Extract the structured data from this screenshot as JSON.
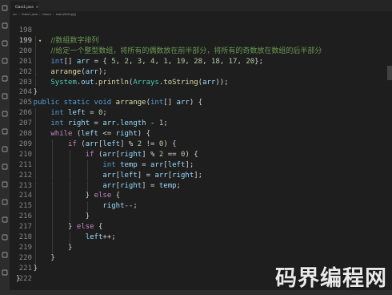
{
  "tab": {
    "label": "Class1.java"
  },
  "breadcrumb": [
    "src",
    "Class1.java",
    "Class1",
    "main(String[])"
  ],
  "lines": [
    {
      "n": "198",
      "indent": 0,
      "parts": []
    },
    {
      "n": "199",
      "indent": 2,
      "parts": [
        {
          "c": "cmt",
          "t": "//数组数字排列"
        }
      ],
      "marker": "💡"
    },
    {
      "n": "200",
      "indent": 2,
      "parts": [
        {
          "c": "cmt",
          "t": "//给定一个整型数组，将所有的偶数放在前半部分，将所有的奇数放在数组的后半部分"
        }
      ]
    },
    {
      "n": "201",
      "indent": 2,
      "parts": [
        {
          "c": "kw",
          "t": "int"
        },
        {
          "c": "",
          "t": "[] "
        },
        {
          "c": "var",
          "t": "arr"
        },
        {
          "c": "",
          "t": " = { "
        },
        {
          "c": "num",
          "t": "5"
        },
        {
          "c": "",
          "t": ", "
        },
        {
          "c": "num",
          "t": "2"
        },
        {
          "c": "",
          "t": ", "
        },
        {
          "c": "num",
          "t": "3"
        },
        {
          "c": "",
          "t": ", "
        },
        {
          "c": "num",
          "t": "4"
        },
        {
          "c": "",
          "t": ", "
        },
        {
          "c": "num",
          "t": "1"
        },
        {
          "c": "",
          "t": ", "
        },
        {
          "c": "num",
          "t": "19"
        },
        {
          "c": "",
          "t": ", "
        },
        {
          "c": "num",
          "t": "28"
        },
        {
          "c": "",
          "t": ", "
        },
        {
          "c": "num",
          "t": "18"
        },
        {
          "c": "",
          "t": ", "
        },
        {
          "c": "num",
          "t": "17"
        },
        {
          "c": "",
          "t": ", "
        },
        {
          "c": "num",
          "t": "20"
        },
        {
          "c": "",
          "t": "};"
        }
      ]
    },
    {
      "n": "202",
      "indent": 2,
      "parts": [
        {
          "c": "fn",
          "t": "arrange"
        },
        {
          "c": "",
          "t": "("
        },
        {
          "c": "var",
          "t": "arr"
        },
        {
          "c": "",
          "t": ");"
        }
      ]
    },
    {
      "n": "203",
      "indent": 2,
      "parts": [
        {
          "c": "typ",
          "t": "System"
        },
        {
          "c": "",
          "t": "."
        },
        {
          "c": "var",
          "t": "out"
        },
        {
          "c": "",
          "t": "."
        },
        {
          "c": "fn",
          "t": "println"
        },
        {
          "c": "",
          "t": "("
        },
        {
          "c": "typ",
          "t": "Arrays"
        },
        {
          "c": "",
          "t": "."
        },
        {
          "c": "fn",
          "t": "toString"
        },
        {
          "c": "",
          "t": "("
        },
        {
          "c": "var",
          "t": "arr"
        },
        {
          "c": "",
          "t": "));"
        }
      ]
    },
    {
      "n": "204",
      "indent": 1,
      "parts": [
        {
          "c": "",
          "t": "}"
        }
      ]
    },
    {
      "n": "205",
      "indent": 1,
      "parts": [
        {
          "c": "kw",
          "t": "public"
        },
        {
          "c": "",
          "t": " "
        },
        {
          "c": "kw",
          "t": "static"
        },
        {
          "c": "",
          "t": " "
        },
        {
          "c": "kw",
          "t": "void"
        },
        {
          "c": "",
          "t": " "
        },
        {
          "c": "fn",
          "t": "arrange"
        },
        {
          "c": "",
          "t": "("
        },
        {
          "c": "kw",
          "t": "int"
        },
        {
          "c": "",
          "t": "[] "
        },
        {
          "c": "var",
          "t": "arr"
        },
        {
          "c": "",
          "t": ") {"
        }
      ]
    },
    {
      "n": "206",
      "indent": 2,
      "parts": [
        {
          "c": "kw",
          "t": "int"
        },
        {
          "c": "",
          "t": " "
        },
        {
          "c": "var",
          "t": "left"
        },
        {
          "c": "",
          "t": " = "
        },
        {
          "c": "num",
          "t": "0"
        },
        {
          "c": "",
          "t": ";"
        }
      ]
    },
    {
      "n": "207",
      "indent": 2,
      "parts": [
        {
          "c": "kw",
          "t": "int"
        },
        {
          "c": "",
          "t": " "
        },
        {
          "c": "var",
          "t": "right"
        },
        {
          "c": "",
          "t": " = "
        },
        {
          "c": "var",
          "t": "arr"
        },
        {
          "c": "",
          "t": "."
        },
        {
          "c": "var",
          "t": "length"
        },
        {
          "c": "",
          "t": " - "
        },
        {
          "c": "num",
          "t": "1"
        },
        {
          "c": "",
          "t": ";"
        }
      ]
    },
    {
      "n": "208",
      "indent": 2,
      "parts": [
        {
          "c": "ctl",
          "t": "while"
        },
        {
          "c": "",
          "t": " ("
        },
        {
          "c": "var",
          "t": "left"
        },
        {
          "c": "",
          "t": " <= "
        },
        {
          "c": "var",
          "t": "right"
        },
        {
          "c": "",
          "t": ") {"
        }
      ]
    },
    {
      "n": "209",
      "indent": 3,
      "parts": [
        {
          "c": "ctl",
          "t": "if"
        },
        {
          "c": "",
          "t": " ("
        },
        {
          "c": "var",
          "t": "arr"
        },
        {
          "c": "",
          "t": "["
        },
        {
          "c": "var",
          "t": "left"
        },
        {
          "c": "",
          "t": "] % "
        },
        {
          "c": "num",
          "t": "2"
        },
        {
          "c": "",
          "t": " != "
        },
        {
          "c": "num",
          "t": "0"
        },
        {
          "c": "",
          "t": ") {"
        }
      ]
    },
    {
      "n": "210",
      "indent": 4,
      "parts": [
        {
          "c": "ctl",
          "t": "if"
        },
        {
          "c": "",
          "t": " ("
        },
        {
          "c": "var",
          "t": "arr"
        },
        {
          "c": "",
          "t": "["
        },
        {
          "c": "var",
          "t": "right"
        },
        {
          "c": "",
          "t": "] % "
        },
        {
          "c": "num",
          "t": "2"
        },
        {
          "c": "",
          "t": " == "
        },
        {
          "c": "num",
          "t": "0"
        },
        {
          "c": "",
          "t": ") {"
        }
      ]
    },
    {
      "n": "211",
      "indent": 5,
      "parts": [
        {
          "c": "kw",
          "t": "int"
        },
        {
          "c": "",
          "t": " "
        },
        {
          "c": "var",
          "t": "temp"
        },
        {
          "c": "",
          "t": " = "
        },
        {
          "c": "var",
          "t": "arr"
        },
        {
          "c": "",
          "t": "["
        },
        {
          "c": "var",
          "t": "left"
        },
        {
          "c": "",
          "t": "];"
        }
      ]
    },
    {
      "n": "212",
      "indent": 5,
      "parts": [
        {
          "c": "var",
          "t": "arr"
        },
        {
          "c": "",
          "t": "["
        },
        {
          "c": "var",
          "t": "left"
        },
        {
          "c": "",
          "t": "] = "
        },
        {
          "c": "var",
          "t": "arr"
        },
        {
          "c": "",
          "t": "["
        },
        {
          "c": "var",
          "t": "right"
        },
        {
          "c": "",
          "t": "];"
        }
      ]
    },
    {
      "n": "213",
      "indent": 5,
      "parts": [
        {
          "c": "var",
          "t": "arr"
        },
        {
          "c": "",
          "t": "["
        },
        {
          "c": "var",
          "t": "right"
        },
        {
          "c": "",
          "t": "] = "
        },
        {
          "c": "var",
          "t": "temp"
        },
        {
          "c": "",
          "t": ";"
        }
      ]
    },
    {
      "n": "214",
      "indent": 4,
      "parts": [
        {
          "c": "",
          "t": "} "
        },
        {
          "c": "ctl",
          "t": "else"
        },
        {
          "c": "",
          "t": " {"
        }
      ]
    },
    {
      "n": "215",
      "indent": 5,
      "parts": [
        {
          "c": "var",
          "t": "right"
        },
        {
          "c": "",
          "t": "--;"
        }
      ]
    },
    {
      "n": "216",
      "indent": 4,
      "parts": [
        {
          "c": "",
          "t": "}"
        }
      ]
    },
    {
      "n": "217",
      "indent": 3,
      "parts": [
        {
          "c": "",
          "t": "} "
        },
        {
          "c": "ctl",
          "t": "else"
        },
        {
          "c": "",
          "t": " {"
        }
      ]
    },
    {
      "n": "218",
      "indent": 4,
      "parts": [
        {
          "c": "var",
          "t": "left"
        },
        {
          "c": "",
          "t": "++;"
        }
      ]
    },
    {
      "n": "219",
      "indent": 3,
      "parts": [
        {
          "c": "",
          "t": "}"
        }
      ]
    },
    {
      "n": "220",
      "indent": 2,
      "parts": [
        {
          "c": "",
          "t": "}"
        }
      ]
    },
    {
      "n": "221",
      "indent": 1,
      "parts": [
        {
          "c": "",
          "t": "}"
        }
      ]
    },
    {
      "n": "222",
      "indent": 0,
      "parts": [
        {
          "c": "",
          "t": "}"
        }
      ]
    }
  ],
  "activity_icons": [
    "files-icon",
    "search-icon",
    "source-control-icon",
    "run-debug-icon",
    "extensions-icon",
    "outline-icon",
    "testing-icon",
    "java-projects-icon",
    "maven-icon",
    "database-icon",
    "terminal-icon",
    "bookmark-icon",
    "remote-icon",
    "docker-icon",
    "account-icon",
    "settings-icon"
  ],
  "watermark": "码界编程网"
}
